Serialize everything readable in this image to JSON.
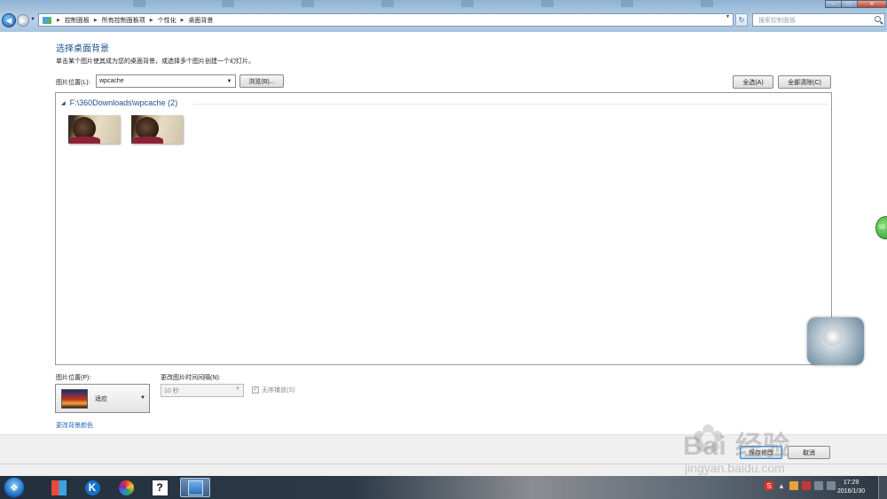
{
  "window": {
    "address": {
      "crumbs": [
        "控制面板",
        "所有控制面板项",
        "个性化",
        "桌面背景"
      ]
    },
    "search_placeholder": "搜索控制面板"
  },
  "page": {
    "title": "选择桌面背景",
    "description": "单击某个图片使其成为您的桌面背景，或选择多个图片创建一个幻灯片。",
    "location_label": "图片位置(L):",
    "location_value": "wpcache",
    "browse_button": "浏览(B)...",
    "select_all_button": "全选(A)",
    "clear_all_button": "全部清除(C)",
    "group": {
      "header": "F:\\360Downloads\\wpcache (2)",
      "thumbnails": [
        "wallpaper-1",
        "wallpaper-2"
      ]
    },
    "position_label": "图片位置(P):",
    "position_value": "适应",
    "interval_label": "更改图片时间间隔(N):",
    "interval_value": "10 秒",
    "shuffle_label": "无序播放(S)",
    "shuffle_checked": true,
    "change_color_link": "更改背景颜色",
    "save_button": "保存修改",
    "cancel_button": "取消"
  },
  "overlays": {
    "green_badge": "55",
    "watermark_brand": "Bai 经验",
    "watermark_url": "jingyan.baidu.com"
  },
  "taskbar": {
    "apps": [
      "windows-tiles",
      "k-app",
      "color-wheel-app",
      "help-app",
      "control-panel-app"
    ],
    "clock_time": "17:29",
    "clock_date": "2016/1/30"
  },
  "colors": {
    "link_blue": "#1f63b8",
    "title_blue": "#1e4f8e",
    "chrome_blue": "#b9d1e8"
  }
}
